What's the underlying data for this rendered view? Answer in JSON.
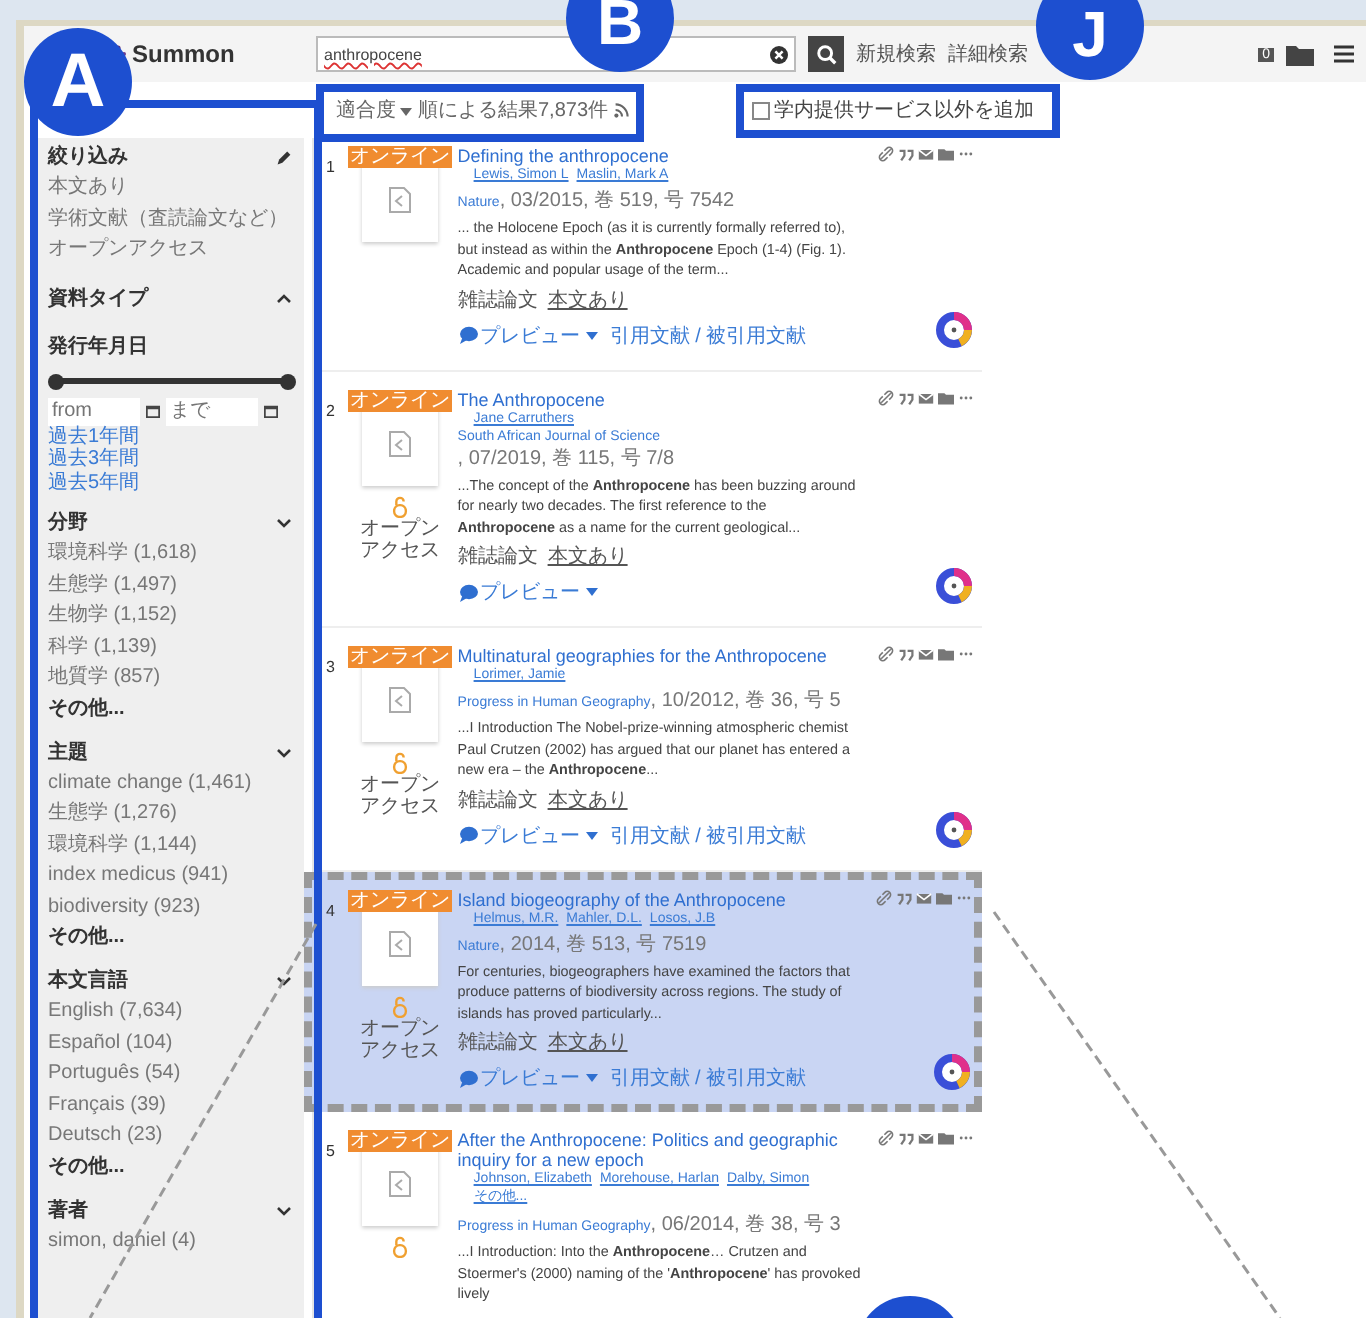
{
  "header": {
    "logo": "Summon",
    "search_value": "anthropocene",
    "links": [
      "新規検索",
      "詳細検索"
    ],
    "folder_count": "0"
  },
  "annotations": [
    {
      "letter": "A"
    },
    {
      "letter": "B"
    },
    {
      "letter": "J"
    }
  ],
  "toolbar": {
    "sort": "適合度",
    "summary": "順による結果7,873件",
    "checkbox_label": "学内提供サービス以外を追加",
    "checkbox_checked": false
  },
  "sidebar": {
    "refine": {
      "title": "絞り込み",
      "items": [
        "本文あり",
        "学術文献（査読論文など）",
        "オープンアクセス"
      ]
    },
    "type_facet": {
      "title": "資料タイプ",
      "expanded": false
    },
    "date": {
      "title": "発行年月日",
      "slider": {
        "level": 1
      },
      "from_placeholder": "from",
      "to_placeholder": "まで",
      "links": [
        "過去1年間",
        "過去3年間",
        "過去5年間"
      ]
    },
    "facets": [
      {
        "title": "分野",
        "expanded": true,
        "items": [
          "環境科学 (1,618)",
          "生態学 (1,497)",
          "生物学 (1,152)",
          "科学 (1,139)",
          "地質学 (857)"
        ],
        "more": "その他..."
      },
      {
        "title": "主題",
        "expanded": true,
        "items": [
          "climate change (1,461)",
          "生態学 (1,276)",
          "環境科学 (1,144)",
          "index medicus (941)",
          "biodiversity (923)"
        ],
        "more": "その他..."
      },
      {
        "title": "本文言語",
        "expanded": true,
        "items": [
          "English (7,634)",
          "Español (104)",
          "Português (54)",
          "Français (39)",
          "Deutsch (23)"
        ],
        "more": "その他..."
      },
      {
        "title": "著者",
        "expanded": true,
        "items": [
          "simon, daniel (4)"
        ]
      }
    ]
  },
  "results": [
    {
      "number": "1",
      "badge": "オンライン",
      "title": "Defining the anthropocene",
      "authors": [
        "Lewis, Simon L",
        "Maslin, Mark A"
      ],
      "journal": "Nature",
      "details": ", 03/2015, 巻 519, 号 7542",
      "snippet": "... the Holocene Epoch (as it is currently formally referred to), but instead as within the **Anthropocene** Epoch (1-4) (Fig. 1). Academic and popular usage of the term...",
      "doc_type": "雑誌論文",
      "fulltext": "本文あり",
      "open_access": false,
      "preview": "プレビュー",
      "citations": "引用文献 / 被引用文献",
      "highlighted": false
    },
    {
      "number": "2",
      "badge": "オンライン",
      "title": "The Anthropocene",
      "authors": [
        "Jane Carruthers"
      ],
      "journal": "South African Journal of Science",
      "details": ", 07/2019, 巻 115, 号 7/8",
      "snippet": "...The concept of the **Anthropocene** has been buzzing around for nearly two decades. The first reference to the **Anthropocene** as a name for the current geological...",
      "doc_type": "雑誌論文",
      "fulltext": "本文あり",
      "open_access": true,
      "oa_label": "オープンアクセス",
      "preview": "プレビュー",
      "highlighted": false
    },
    {
      "number": "3",
      "badge": "オンライン",
      "title": "Multinatural geographies for the Anthropocene",
      "authors": [
        "Lorimer, Jamie"
      ],
      "journal": "Progress in Human Geography",
      "details": ", 10/2012, 巻 36, 号 5",
      "snippet": "...I Introduction The Nobel-prize-winning atmospheric chemist Paul Crutzen (2002) has argued that our planet has entered a new era – the **Anthropocene**...",
      "doc_type": "雑誌論文",
      "fulltext": "本文あり",
      "open_access": true,
      "oa_label": "オープンアクセス",
      "preview": "プレビュー",
      "citations": "引用文献 / 被引用文献",
      "highlighted": false
    },
    {
      "number": "4",
      "badge": "オンライン",
      "title": "Island biogeography of the Anthropocene",
      "authors": [
        "Helmus, M.R.",
        "Mahler, D.L.",
        "Losos, J.B"
      ],
      "journal": "Nature",
      "details": ", 2014, 巻 513, 号 7519",
      "snippet": "For centuries, biogeographers have examined the factors that produce patterns of biodiversity across regions. The study of islands has proved particularly...",
      "doc_type": "雑誌論文",
      "fulltext": "本文あり",
      "open_access": true,
      "oa_label": "オープンアクセス",
      "preview": "プレビュー",
      "citations": "引用文献 / 被引用文献",
      "highlighted": true
    },
    {
      "number": "5",
      "badge": "オンライン",
      "title": "After the Anthropocene: Politics and geographic inquiry for a new epoch",
      "authors": [
        "Johnson, Elizabeth",
        "Morehouse, Harlan",
        "Dalby, Simon",
        "その他..."
      ],
      "journal": "Progress in Human Geography",
      "details": ", 06/2014, 巻 38, 号 3",
      "snippet": "...I Introduction: Into the **Anthropocene**… Crutzen and Stoermer's (2000) naming of the '**Anthropocene**' has provoked lively",
      "open_access": true,
      "highlighted": false
    }
  ]
}
